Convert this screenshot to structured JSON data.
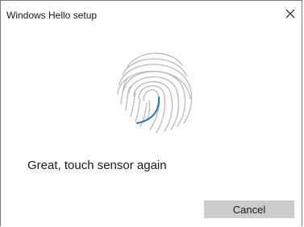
{
  "dialog": {
    "title": "Windows Hello setup",
    "message": "Great, touch sensor again",
    "cancel_label": "Cancel",
    "close_icon": "close-icon",
    "fingerprint_icon": "fingerprint-icon"
  },
  "colors": {
    "fingerprint_gray": "#b9b9b9",
    "fingerprint_progress": "#2c7bb5",
    "button_bg": "#cccccc"
  }
}
